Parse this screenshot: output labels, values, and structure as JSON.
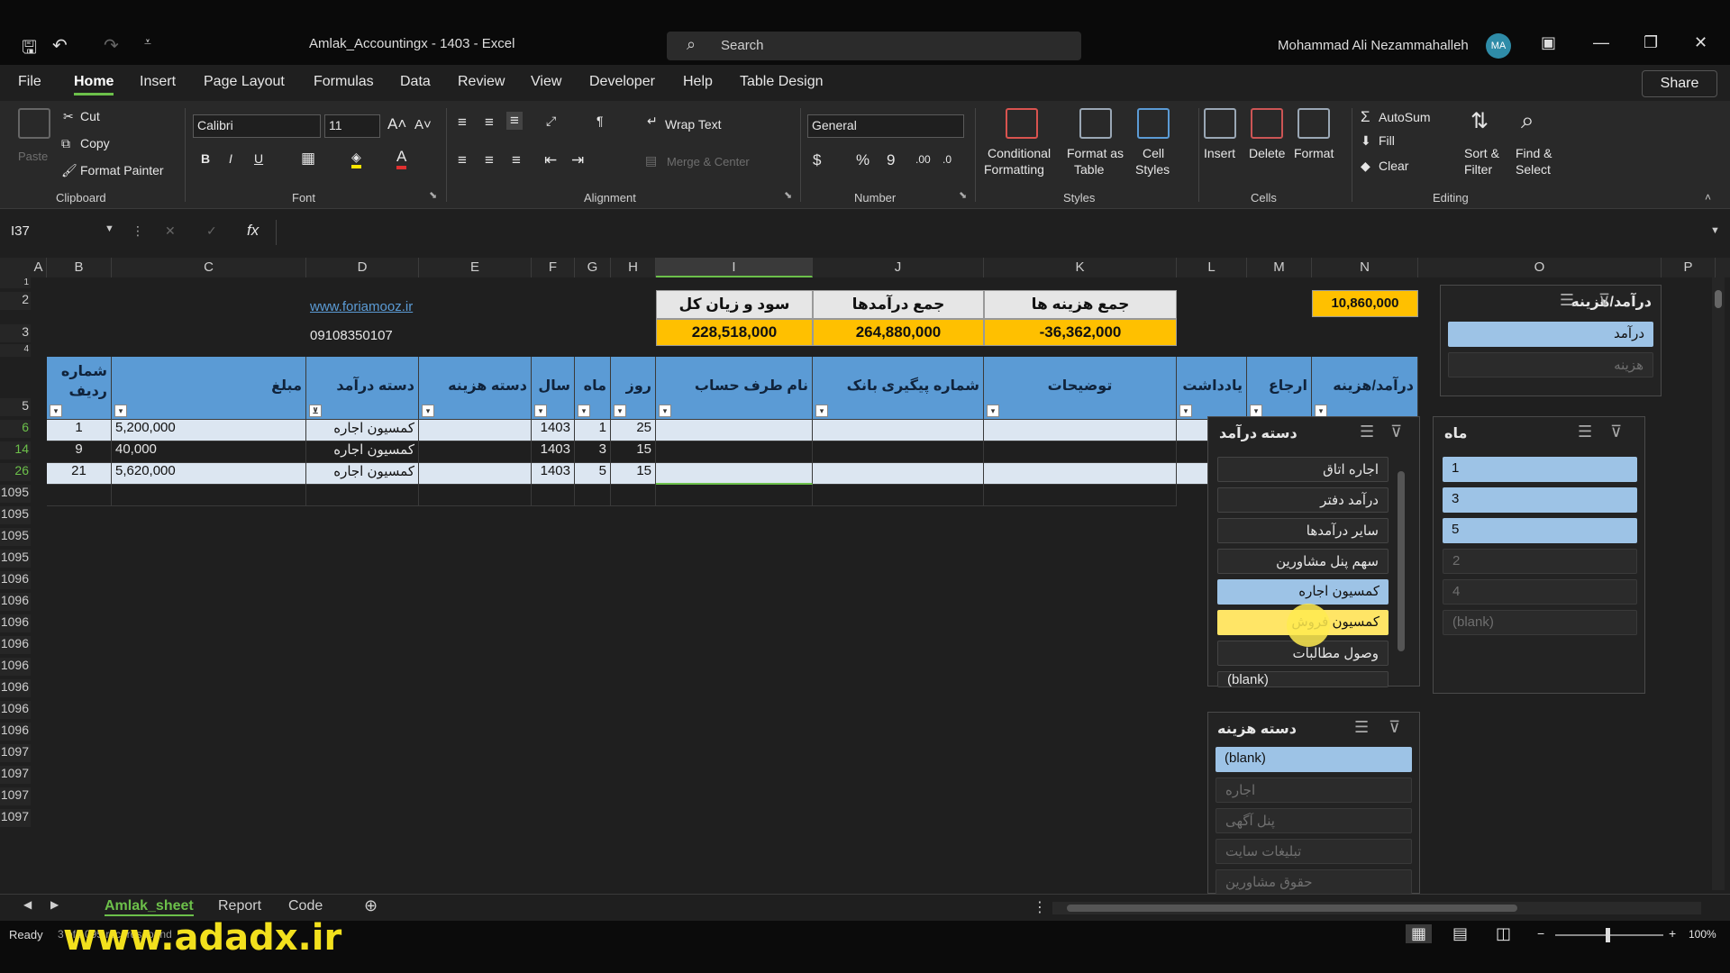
{
  "titlebar": {
    "title": "Amlak_Accountingx - 1403  -  Excel",
    "search_placeholder": "Search",
    "user": "Mohammad Ali Nezammahalleh",
    "avatar": "MA"
  },
  "menu": {
    "tabs": [
      "File",
      "Home",
      "Insert",
      "Page Layout",
      "Formulas",
      "Data",
      "Review",
      "View",
      "Developer",
      "Help",
      "Table Design"
    ],
    "active": "Home",
    "share": "Share"
  },
  "ribbon": {
    "clipboard": {
      "cut": "Cut",
      "copy": "Copy",
      "format_painter": "Format Painter",
      "paste": "Paste",
      "label": "Clipboard"
    },
    "font": {
      "name": "Calibri",
      "size": "11",
      "label": "Font"
    },
    "alignment": {
      "wrap": "Wrap Text",
      "merge": "Merge & Center",
      "label": "Alignment"
    },
    "number": {
      "format": "General",
      "label": "Number"
    },
    "styles": {
      "conditional": "Conditional",
      "conditional2": "Formatting",
      "format_table": "Format as",
      "format_table2": "Table",
      "cell_styles": "Cell",
      "cell_styles2": "Styles",
      "label": "Styles"
    },
    "cells": {
      "insert": "Insert",
      "delete": "Delete",
      "format": "Format",
      "label": "Cells"
    },
    "editing": {
      "autosum": "AutoSum",
      "fill": "Fill",
      "clear": "Clear",
      "sort": "Sort &",
      "sort2": "Filter",
      "find": "Find &",
      "find2": "Select",
      "label": "Editing"
    }
  },
  "formula_bar": {
    "name_box": "I37",
    "fx": "fx"
  },
  "columns": [
    "A",
    "B",
    "C",
    "D",
    "E",
    "F",
    "G",
    "H",
    "I",
    "J",
    "K",
    "L",
    "M",
    "N",
    "O",
    "P"
  ],
  "rows": [
    "1",
    "2",
    "3",
    "4",
    "5",
    "6",
    "14",
    "26",
    "1095",
    "1095",
    "1095",
    "1095",
    "1096",
    "1096",
    "1096",
    "1096",
    "1096",
    "1096",
    "1096",
    "1096",
    "1097",
    "1097",
    "1097",
    "1097"
  ],
  "sheet": {
    "website": "www.foriamooz.ir",
    "phone": "09108350107",
    "summary_headers": [
      "سود و زیان کل",
      "جمع درآمدها",
      "جمع هزینه ها"
    ],
    "summary_values": [
      "228,518,000",
      "264,880,000",
      "-36,362,000"
    ],
    "n2_value": "10,860,000",
    "table_headers": {
      "B": "شماره ردیف",
      "C": "مبلغ",
      "D": "دسته درآمد",
      "E": "دسته هزینه",
      "F": "سال",
      "G": "ماه",
      "H": "روز",
      "I": "نام طرف حساب",
      "J": "شماره پیگیری بانک",
      "K": "توضیحات",
      "L": "یادداشت",
      "M": "ارجاع",
      "N": "درآمد/هزینه"
    },
    "data_rows": [
      {
        "b": "1",
        "c": "5,200,000",
        "d": "کمسیون اجاره",
        "f": "1403",
        "g": "1",
        "h": "25"
      },
      {
        "b": "9",
        "c": "40,000",
        "d": "کمسیون اجاره",
        "f": "1403",
        "g": "3",
        "h": "15"
      },
      {
        "b": "21",
        "c": "5,620,000",
        "d": "کمسیون اجاره",
        "f": "1403",
        "g": "5",
        "h": "15"
      }
    ]
  },
  "slicers": {
    "income_expense": {
      "title": "درآمد/هزینه",
      "items": [
        "درآمد",
        "هزینه"
      ]
    },
    "income_cat": {
      "title": "دسته درآمد",
      "items": [
        "اجاره اتاق",
        "درآمد دفتر",
        "سایر درآمدها",
        "سهم پنل مشاورین",
        "کمسیون اجاره",
        "کمسیون فروش",
        "وصول مطالبات",
        "(blank)"
      ]
    },
    "month": {
      "title": "ماه",
      "items": [
        "1",
        "3",
        "5",
        "2",
        "4",
        "(blank)"
      ]
    },
    "expense_cat": {
      "title": "دسته هزینه",
      "items": [
        "(blank)",
        "اجاره",
        "پنل آگهی",
        "تبلیغات سایت",
        "حقوق مشاورین"
      ]
    }
  },
  "sheet_tabs": [
    "Amlak_sheet",
    "Report",
    "Code"
  ],
  "status": {
    "ready": "Ready",
    "records": "3 of 1095 records found",
    "zoom": "100%"
  },
  "watermark": "www.adadx.ir",
  "colors": {
    "header_blue": "#5b9bd5",
    "summary_yellow": "#ffc000",
    "slicer_selected": "#9dc3e6",
    "accent_green": "#6cc04a"
  }
}
